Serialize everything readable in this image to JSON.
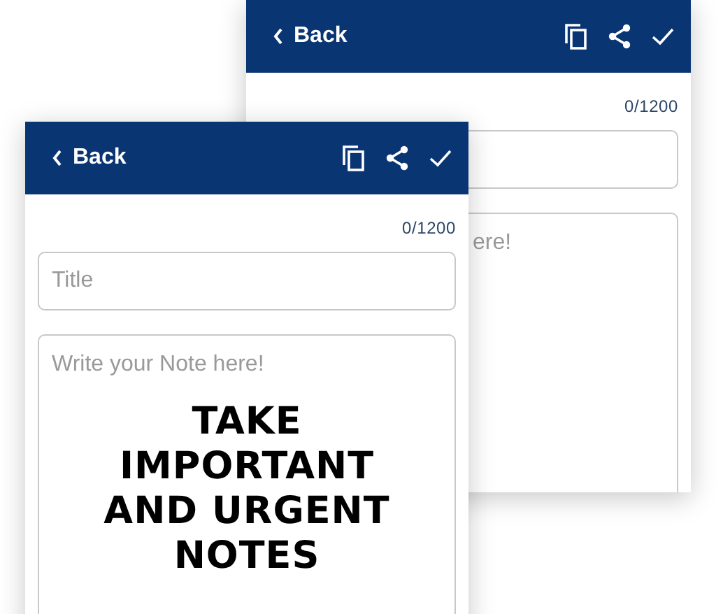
{
  "screens": [
    {
      "kind": "back",
      "back_label": "Back",
      "counter": "0/1200",
      "note_placeholder": "ere!"
    },
    {
      "kind": "front",
      "back_label": "Back",
      "counter": "0/1200",
      "title_placeholder": "Title",
      "note_placeholder": "Write your Note here!",
      "headline": [
        "TAKE",
        "IMPORTANT",
        "AND URGENT",
        "NOTES"
      ]
    }
  ]
}
